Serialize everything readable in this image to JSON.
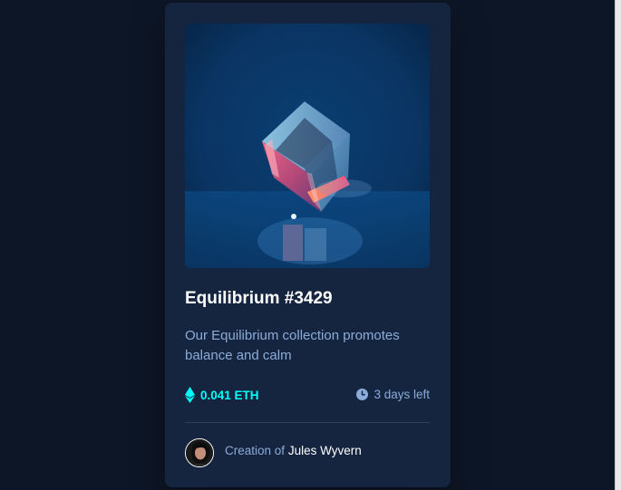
{
  "card": {
    "title": "Equilibrium #3429",
    "description": "Our Equilibrium collection promotes balance and calm",
    "price": "0.041 ETH",
    "time_left": "3 days left",
    "creator_prefix": "Creation of",
    "creator_name": "Jules Wyvern"
  },
  "icons": {
    "price": "ethereum-icon",
    "time": "clock-icon"
  },
  "colors": {
    "page_bg": "#0d1626",
    "card_bg": "#15253f",
    "accent_cyan": "#00fff8",
    "soft_blue": "#8bacd9",
    "white": "#ffffff",
    "divider": "#2e405a"
  }
}
